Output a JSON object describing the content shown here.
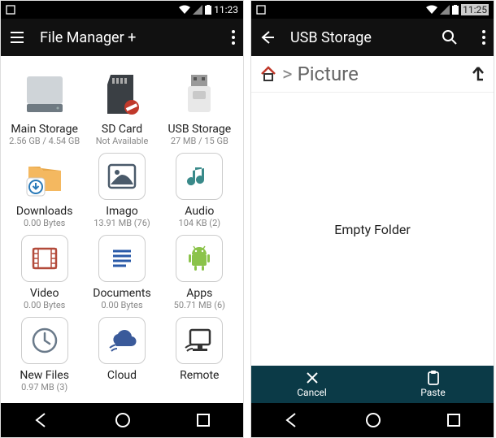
{
  "left": {
    "statusbar": {
      "time": "11:23"
    },
    "appbar": {
      "title": "File Manager +"
    },
    "grid": {
      "items": [
        {
          "label": "Main Storage",
          "sublabel": "2.56 GB / 4.54 GB"
        },
        {
          "label": "SD Card",
          "sublabel": "Not Available"
        },
        {
          "label": "USB Storage",
          "sublabel": "27 MB / 15 GB"
        },
        {
          "label": "Downloads",
          "sublabel": "0.00 Bytes"
        },
        {
          "label": "Imago",
          "sublabel": "13.91 MB (76)"
        },
        {
          "label": "Audio",
          "sublabel": "104 KB (2)"
        },
        {
          "label": "Video",
          "sublabel": "0.00 Bytes"
        },
        {
          "label": "Documents",
          "sublabel": "0.00 Bytes"
        },
        {
          "label": "Apps",
          "sublabel": "50.71 MB (6)"
        },
        {
          "label": "New Files",
          "sublabel": "0.97 MB (3)"
        },
        {
          "label": "Cloud",
          "sublabel": ""
        },
        {
          "label": "Remote",
          "sublabel": ""
        }
      ]
    }
  },
  "right": {
    "statusbar": {
      "time": "11:25"
    },
    "appbar": {
      "title": "USB Storage"
    },
    "breadcrumb": {
      "path": "Picture"
    },
    "empty_text": "Empty Folder",
    "actions": {
      "cancel": "Cancel",
      "paste": "Paste"
    }
  }
}
